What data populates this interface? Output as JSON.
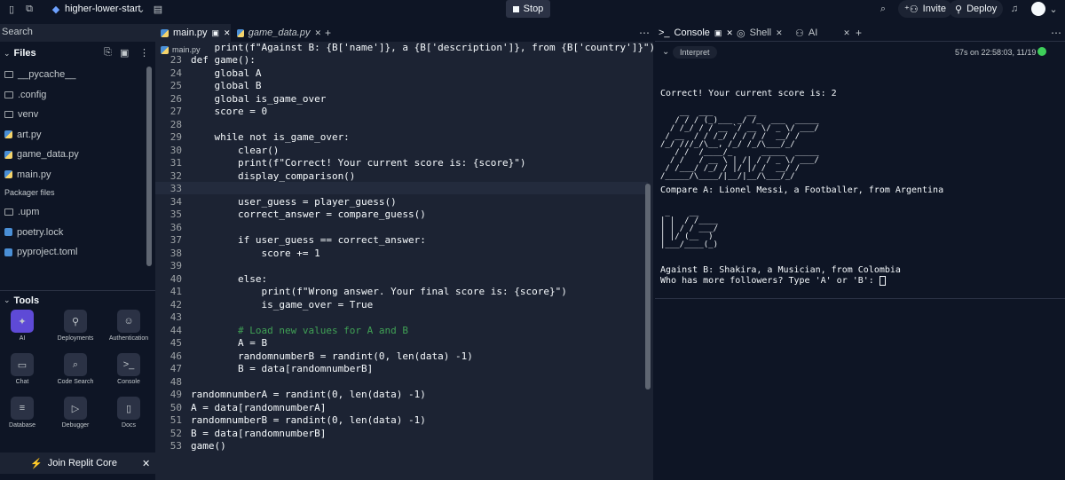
{
  "topbar": {
    "repl_name": "higher-lower-start",
    "stop_label": "Stop",
    "invite_label": "Invite",
    "deploy_label": "Deploy"
  },
  "sidebar": {
    "search_placeholder": "Search",
    "files_title": "Files",
    "files": [
      {
        "name": "__pycache__",
        "type": "folder"
      },
      {
        "name": ".config",
        "type": "folder"
      },
      {
        "name": "venv",
        "type": "folder"
      },
      {
        "name": "art.py",
        "type": "py"
      },
      {
        "name": "game_data.py",
        "type": "py"
      },
      {
        "name": "main.py",
        "type": "py"
      }
    ],
    "packager_title": "Packager files",
    "packager_files": [
      {
        "name": ".upm",
        "type": "folder"
      },
      {
        "name": "poetry.lock",
        "type": "file"
      },
      {
        "name": "pyproject.toml",
        "type": "file"
      }
    ],
    "tools_title": "Tools",
    "tools": [
      {
        "label": "AI",
        "icon": "ai-icon"
      },
      {
        "label": "Deployments",
        "icon": "deployments-icon"
      },
      {
        "label": "Authentication",
        "icon": "authentication-icon"
      },
      {
        "label": "Chat",
        "icon": "chat-icon"
      },
      {
        "label": "Code Search",
        "icon": "code-search-icon"
      },
      {
        "label": "Console",
        "icon": "console-icon"
      },
      {
        "label": "Database",
        "icon": "database-icon"
      },
      {
        "label": "Debugger",
        "icon": "debugger-icon"
      },
      {
        "label": "Docs",
        "icon": "docs-icon"
      }
    ],
    "join_label": "Join Replit Core"
  },
  "editor": {
    "tabs": [
      "main.py",
      "game_data.py"
    ],
    "breadcrumb": "main.py",
    "line_numbers": [
      "23",
      "24",
      "25",
      "26",
      "27",
      "28",
      "29",
      "30",
      "31",
      "32",
      "33",
      "34",
      "35",
      "36",
      "37",
      "38",
      "39",
      "40",
      "41",
      "42",
      "43",
      "44",
      "45",
      "46",
      "47",
      "48",
      "49",
      "50",
      "51",
      "52",
      "53"
    ],
    "code_lines": [
      "    print(f\"Against B: {B['name']}, a {B['description']}, from {B['country']}\")",
      "def game():",
      "    global A",
      "    global B",
      "    global is_game_over",
      "    score = 0",
      "",
      "    while not is_game_over:",
      "        clear()",
      "        print(f\"Correct! Your current score is: {score}\")",
      "        display_comparison()",
      "",
      "        user_guess = player_guess()",
      "        correct_answer = compare_guess()",
      "",
      "        if user_guess == correct_answer:",
      "            score += 1",
      "",
      "        else:",
      "            print(f\"Wrong answer. Your final score is: {score}\")",
      "            is_game_over = True",
      "",
      "        # Load new values for A and B",
      "        A = B",
      "        randomnumberB = randint(0, len(data) -1)",
      "        B = data[randomnumberB]",
      "",
      "randomnumberA = randint(0, len(data) -1)",
      "A = data[randomnumberA]",
      "randomnumberB = randint(0, len(data) -1)",
      "B = data[randomnumberB]",
      "game()"
    ]
  },
  "console": {
    "tabs": [
      "Console",
      "Shell",
      "AI"
    ],
    "interpret_label": "Interpret",
    "status": "57s on 22:58:03, 11/19",
    "line1": "Correct! Your current score is: 2",
    "ascii_logo": "    __  ___       __\n   / / / (_)___ _/ /_  ___  _____\n  / /_/ / / __ `/ __ \\/ _ \\/ ___/\n / __  / / /_/ / / / /  __/ /\n/_/ ///_/\\__, /_/ /_/\\___/_/\n   / /  /____/_      _____  _____\n  / /   / __ \\ | /| / / _ \\/ ___/\n / /___/ /_/ / |/ |/ /  __/ /\n/_____/\\____/|__/|__/\\___/_/",
    "compare_a": "Compare A: Lionel Messi, a Footballer, from Argentina",
    "ascii_vs": " _    __\n| |  / /____\n| | / / ___/\n| |/ (__  )\n|___/____(_)",
    "against_b": "Against B: Shakira, a Musician, from Colombia",
    "prompt": "Who has more followers? Type 'A' or 'B': "
  },
  "colors": {
    "bg": "#0e1525",
    "panel": "#1c2333",
    "keyword": "#6da1ff",
    "string": "#f5d46b",
    "number": "#75d4a3",
    "comment": "#40a155",
    "status_green": "#3ecf5a"
  }
}
